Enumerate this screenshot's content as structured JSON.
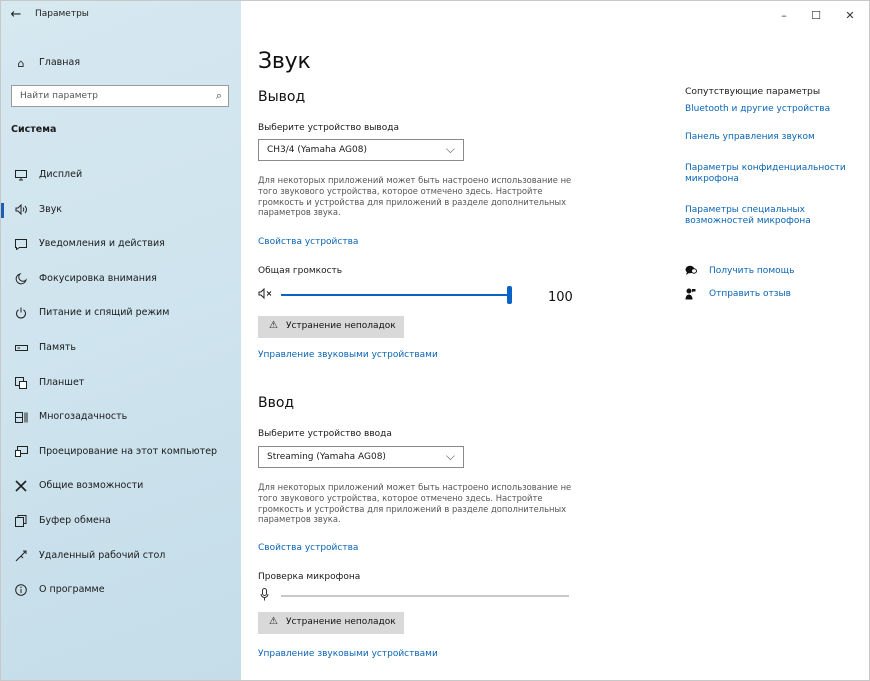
{
  "window": {
    "title": "Параметры",
    "back_icon": "arrow-left-icon",
    "controls": {
      "minimize": "–",
      "maximize": "☐",
      "close": "✕"
    }
  },
  "sidebar": {
    "home_label": "Главная",
    "search_placeholder": "Найти параметр",
    "section_title": "Система",
    "items": [
      {
        "label": "Дисплей",
        "icon": "display-icon",
        "glyph": "🖵"
      },
      {
        "label": "Звук",
        "icon": "speaker-icon",
        "glyph": "🔊"
      },
      {
        "label": "Уведомления и действия",
        "icon": "notification-icon",
        "glyph": "▭"
      },
      {
        "label": "Фокусировка внимания",
        "icon": "moon-icon",
        "glyph": "☽"
      },
      {
        "label": "Питание и спящий режим",
        "icon": "power-icon",
        "glyph": "⏻"
      },
      {
        "label": "Память",
        "icon": "storage-icon",
        "glyph": "▭"
      },
      {
        "label": "Планшет",
        "icon": "tablet-icon",
        "glyph": "⧉"
      },
      {
        "label": "Многозадачность",
        "icon": "multitasking-icon",
        "glyph": "⧈"
      },
      {
        "label": "Проецирование на этот компьютер",
        "icon": "projecting-icon",
        "glyph": "⎚"
      },
      {
        "label": "Общие возможности",
        "icon": "shared-experiences-icon",
        "glyph": "✕"
      },
      {
        "label": "Буфер обмена",
        "icon": "clipboard-icon",
        "glyph": "⎘"
      },
      {
        "label": "Удаленный рабочий стол",
        "icon": "remote-desktop-icon",
        "glyph": "⤫"
      },
      {
        "label": "О программе",
        "icon": "info-icon",
        "glyph": "ⓘ"
      }
    ],
    "active_index": 1
  },
  "main": {
    "title": "Звук",
    "output": {
      "heading": "Вывод",
      "select_label": "Выберите устройство вывода",
      "device": "CH3/4 (Yamaha AG08)",
      "description": "Для некоторых приложений может быть настроено использование не того звукового устройства, которое отмечено здесь. Настройте громкость и устройства для приложений в разделе дополнительных параметров звука.",
      "properties_link": "Свойства устройства",
      "volume_label": "Общая громкость",
      "volume_value": "100",
      "volume_level": 1.0,
      "troubleshoot_label": "Устранение неполадок",
      "manage_link": "Управление звуковыми устройствами"
    },
    "input": {
      "heading": "Ввод",
      "select_label": "Выберите устройство ввода",
      "device": "Streaming (Yamaha AG08)",
      "description": "Для некоторых приложений может быть настроено использование не того звукового устройства, которое отмечено здесь. Настройте громкость и устройства для приложений в разделе дополнительных параметров звука.",
      "properties_link": "Свойства устройства",
      "mic_test_label": "Проверка микрофона",
      "mic_level": 0,
      "troubleshoot_label": "Устранение неполадок",
      "manage_link": "Управление звуковыми устройствами"
    }
  },
  "related": {
    "title": "Сопутствующие параметры",
    "links": [
      "Bluetooth и другие устройства",
      "Панель управления звуком",
      "Параметры конфиденциальности микрофона",
      "Параметры специальных возможностей микрофона"
    ],
    "help_label": "Получить помощь",
    "feedback_label": "Отправить отзыв"
  },
  "colors": {
    "accent": "#0a64c8",
    "link": "#0a64b4",
    "button": "#d9d9d9"
  }
}
